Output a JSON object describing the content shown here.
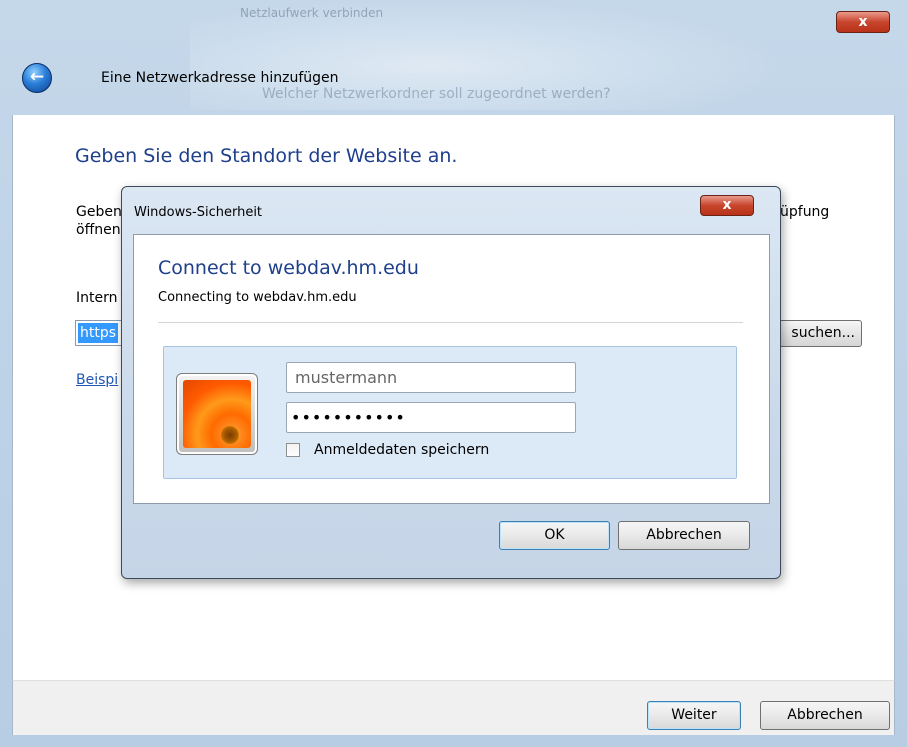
{
  "wizard": {
    "title": "Eine Netzwerkadresse hinzufügen",
    "close_label": "x",
    "heading": "Geben Sie den Standort der Website an.",
    "desc_line1": "Geben",
    "desc_line2": "öffnen",
    "desc_tail": "üpfung",
    "address_label": "Intern",
    "address_value": "https",
    "browse_label": "suchen...",
    "example_link": "Beispi",
    "next_label": "Weiter",
    "cancel_label": "Abbrechen",
    "background_text": "Netzlaufwerk verbinden",
    "background_text2": "Welcher Netzwerkordner soll zugeordnet werden?"
  },
  "security_dialog": {
    "title": "Windows-Sicherheit",
    "close_label": "x",
    "heading": "Connect to webdav.hm.edu",
    "subtitle": "Connecting to webdav.hm.edu",
    "username": "mustermann",
    "password_mask": "•••••••••••",
    "remember_label": "Anmeldedaten speichern",
    "remember_checked": false,
    "ok_label": "OK",
    "cancel_label": "Abbrechen"
  },
  "icons": {
    "back": "back-arrow-icon",
    "avatar": "user-avatar-flower-icon"
  }
}
